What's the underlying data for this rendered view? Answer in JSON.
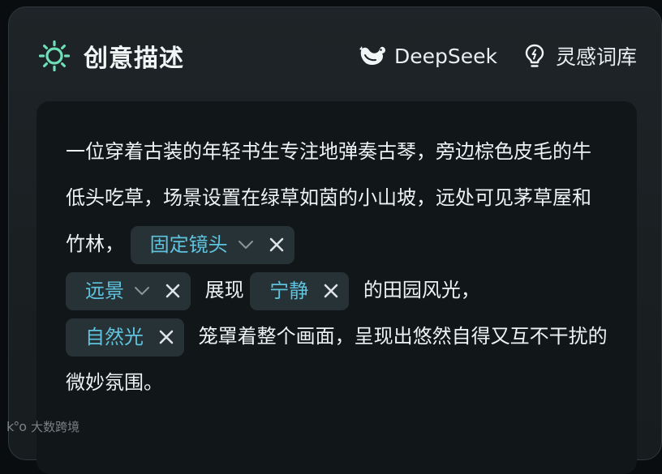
{
  "header": {
    "title": "创意描述",
    "title_icon": "sun-icon",
    "model_label": "DeepSeek",
    "model_icon": "whale-icon",
    "library_label": "灵感词库",
    "library_icon": "lightbulb-icon"
  },
  "description": {
    "text_1": "一位穿着古装的年轻书生专注地弹奏古琴，旁边棕色皮毛的牛低头吃草，场景设置在绿草如茵的小山坡，远处可见茅草屋和竹林，",
    "tag_1": "固定镜头",
    "tag_2": "远景",
    "text_2": "展现",
    "tag_3": "宁静",
    "text_3": "的田园风光，",
    "tag_4": "自然光",
    "text_4": "笼罩着整个画面，呈现出悠然自得又互不干扰的微妙氛围。"
  },
  "watermark": {
    "logo": "k°o",
    "text": "大数跨境"
  },
  "colors": {
    "accent": "#5fc3de",
    "sun_icon": "#6ee0b7",
    "panel_bg": "#1b2123",
    "content_bg": "#111618",
    "tag_bg": "#263236"
  }
}
